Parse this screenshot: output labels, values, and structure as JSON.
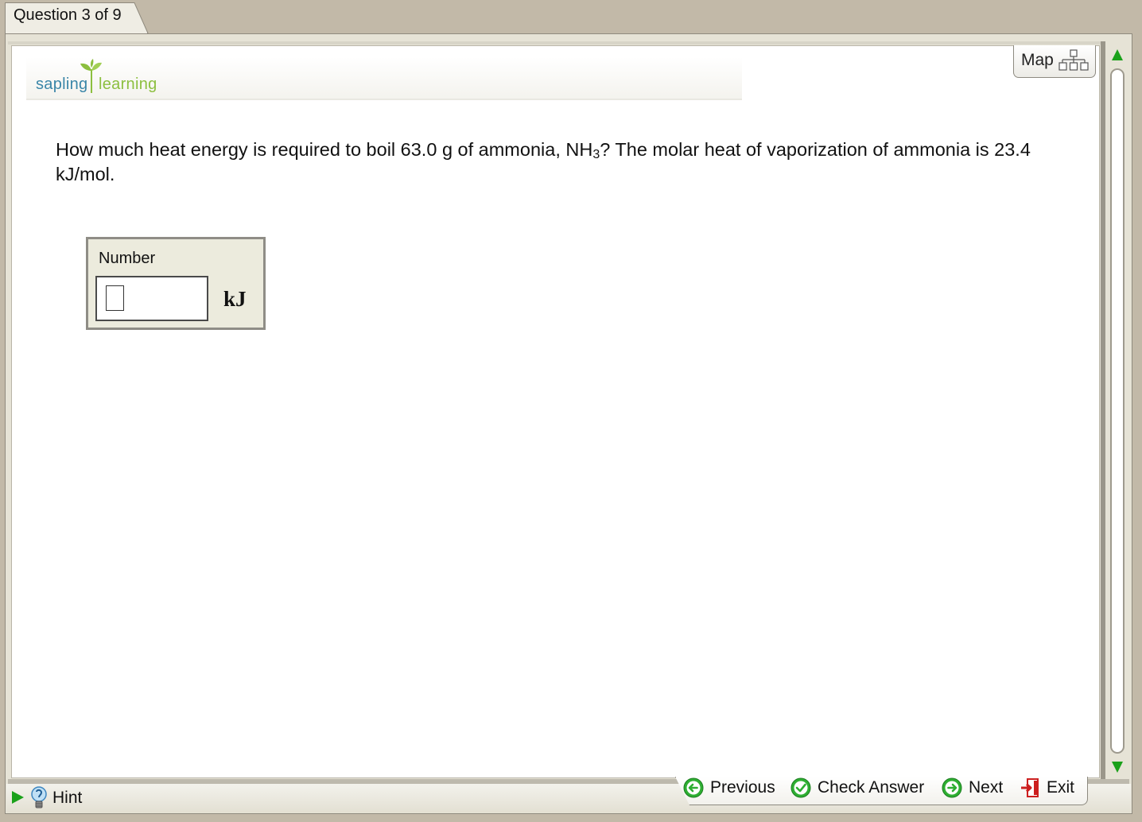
{
  "tab": {
    "label": "Question 3 of 9"
  },
  "logo": {
    "part1": "sapling",
    "part2": "learning"
  },
  "map": {
    "label": "Map",
    "icon": "sitemap-icon"
  },
  "question": {
    "text_before": "How much heat energy is required to boil 63.0 g of ammonia, NH",
    "subscript": "3",
    "text_after": "? The molar heat of vaporization of ammonia is 23.4 kJ/mol."
  },
  "answer": {
    "label": "Number",
    "value": "",
    "unit": "kJ"
  },
  "hint": {
    "label": "Hint",
    "icon": "lightbulb-icon"
  },
  "nav": {
    "previous": "Previous",
    "check": "Check Answer",
    "next": "Next",
    "exit": "Exit"
  },
  "colors": {
    "accent_green": "#1aa11a",
    "logo_blue": "#3a86a8",
    "logo_green": "#8cbf3f",
    "exit_red": "#cc1f1f"
  }
}
